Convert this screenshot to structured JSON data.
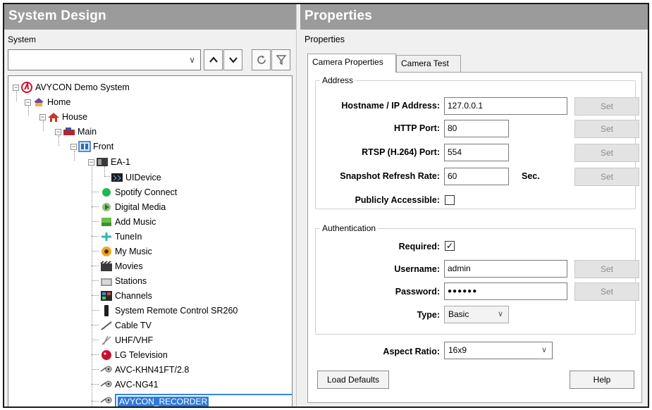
{
  "left_pane": {
    "title": "System Design",
    "sub_label": "System",
    "search": {
      "value": ""
    },
    "tree": [
      {
        "label": "AVYCON Demo System",
        "icon": "avycon-logo-icon",
        "level": 0,
        "expanded": true
      },
      {
        "label": "Home",
        "icon": "home-icon",
        "level": 1,
        "expanded": true
      },
      {
        "label": "House",
        "icon": "house-icon",
        "level": 2,
        "expanded": true
      },
      {
        "label": "Main",
        "icon": "floor-icon",
        "level": 3,
        "expanded": true
      },
      {
        "label": "Front",
        "icon": "room-icon",
        "level": 4,
        "expanded": true
      },
      {
        "label": "EA-1",
        "icon": "controller-icon",
        "level": 5,
        "expanded": true
      },
      {
        "label": "UIDevice",
        "icon": "ui-device-icon",
        "level": 6
      },
      {
        "label": "Spotify Connect",
        "icon": "spotify-icon",
        "level": 5
      },
      {
        "label": "Digital Media",
        "icon": "digital-media-icon",
        "level": 5
      },
      {
        "label": "Add Music",
        "icon": "add-music-icon",
        "level": 5
      },
      {
        "label": "TuneIn",
        "icon": "tunein-icon",
        "level": 5
      },
      {
        "label": "My Music",
        "icon": "my-music-icon",
        "level": 5
      },
      {
        "label": "Movies",
        "icon": "movies-icon",
        "level": 5
      },
      {
        "label": "Stations",
        "icon": "stations-icon",
        "level": 5
      },
      {
        "label": "Channels",
        "icon": "channels-icon",
        "level": 5
      },
      {
        "label": "System Remote Control SR260",
        "icon": "remote-control-icon",
        "level": 5
      },
      {
        "label": "Cable TV",
        "icon": "cable-tv-icon",
        "level": 5
      },
      {
        "label": "UHF/VHF",
        "icon": "antenna-icon",
        "level": 5
      },
      {
        "label": "LG Television",
        "icon": "lg-logo-icon",
        "level": 5
      },
      {
        "label": "AVC-KHN41FT/2.8",
        "icon": "camera-icon",
        "level": 5
      },
      {
        "label": "AVC-NG41",
        "icon": "camera-icon",
        "level": 5
      },
      {
        "label": "AVYCON_RECORDER",
        "icon": "camera-icon",
        "level": 5,
        "selected": true
      }
    ]
  },
  "right_pane": {
    "title": "Properties",
    "sub_label": "Properties",
    "tabs": [
      {
        "label": "Camera Properties",
        "active": true
      },
      {
        "label": "Camera Test",
        "active": false
      }
    ],
    "address": {
      "legend": "Address",
      "hostname": {
        "label": "Hostname / IP Address:",
        "value": "127.0.0.1"
      },
      "http_port": {
        "label": "HTTP Port:",
        "value": "80"
      },
      "rtsp_port": {
        "label": "RTSP (H.264) Port:",
        "value": "554"
      },
      "snapshot": {
        "label": "Snapshot Refresh Rate:",
        "value": "60",
        "unit": "Sec."
      },
      "public": {
        "label": "Publicly Accessible:",
        "checked": false
      },
      "set_label": "Set"
    },
    "auth": {
      "legend": "Authentication",
      "required": {
        "label": "Required:",
        "checked": true,
        "mark": "✓"
      },
      "username": {
        "label": "Username:",
        "value": "admin"
      },
      "password": {
        "label": "Password:",
        "value": "●●●●●●"
      },
      "type": {
        "label": "Type:",
        "value": "Basic"
      },
      "set_label": "Set"
    },
    "aspect": {
      "label": "Aspect Ratio:",
      "value": "16x9"
    },
    "load_defaults": "Load Defaults",
    "help": "Help"
  }
}
